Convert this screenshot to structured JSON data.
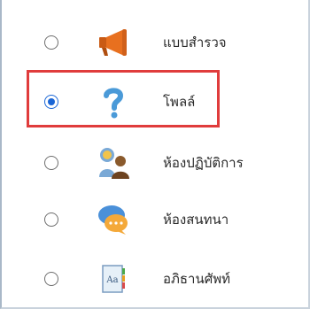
{
  "options": [
    {
      "label": "แบบสำรวจ",
      "icon": "megaphone-icon",
      "selected": false
    },
    {
      "label": "โพลล์",
      "icon": "question-mark-icon",
      "selected": true
    },
    {
      "label": "ห้องปฏิบัติการ",
      "icon": "people-workshop-icon",
      "selected": false
    },
    {
      "label": "ห้องสนทนา",
      "icon": "chat-bubble-icon",
      "selected": false
    },
    {
      "label": "อภิธานศัพท์",
      "icon": "glossary-book-icon",
      "selected": false
    }
  ],
  "glossary_icon_text": "Aa",
  "colors": {
    "highlight": "#e03c3c",
    "radio_selected": "#1a66d6",
    "megaphone": "#e8701f",
    "question": "#4a9ad8",
    "chat": "#4a90d9"
  }
}
